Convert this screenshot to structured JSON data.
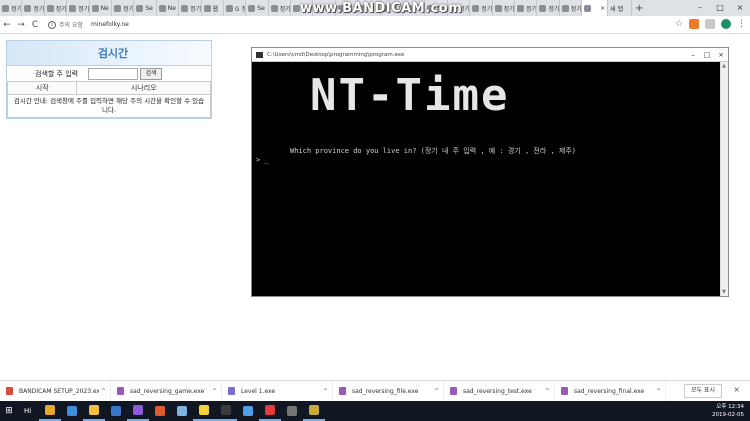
{
  "browser": {
    "tabs": [
      {
        "label": "정기"
      },
      {
        "label": "정기"
      },
      {
        "label": "정기"
      },
      {
        "label": "정기"
      },
      {
        "label": "Ne"
      },
      {
        "label": "정기"
      },
      {
        "label": "Se"
      },
      {
        "label": "Ne"
      },
      {
        "label": "정기"
      },
      {
        "label": "웹"
      },
      {
        "label": "G 정"
      },
      {
        "label": "Se"
      },
      {
        "label": "정기"
      },
      {
        "label": "정기"
      },
      {
        "label": "정기"
      },
      {
        "label": "정기"
      },
      {
        "label": "정기"
      },
      {
        "label": "정기"
      },
      {
        "label": "Ne"
      },
      {
        "label": "정기"
      },
      {
        "label": "정기"
      },
      {
        "label": "정기"
      },
      {
        "label": "정기"
      },
      {
        "label": "정기"
      },
      {
        "label": "정기"
      },
      {
        "label": "정기"
      }
    ],
    "active_tab_close": "×",
    "extra_tab": "새 탭",
    "new_tab": "+",
    "watermark": "www.BANDICAM.com",
    "window_controls": {
      "minimize": "–",
      "maximize": "□",
      "close": "×"
    },
    "address": {
      "security_label": "주의 요함",
      "url": "minefolky.ne"
    },
    "nav": {
      "back": "←",
      "forward": "→",
      "reload": "C"
    }
  },
  "widget": {
    "title": "검시간",
    "search_label": "검색할 주 입력",
    "search_value": "",
    "search_button": "검색",
    "table_headers": [
      "시작",
      "시나리오"
    ],
    "result_text": "검시간 안내: 검색창에 주를 입력하면 해당 주의 시간을 확인할 수 있습니다."
  },
  "console": {
    "title": "C:\\Users\\cmd\\Desktop\\programming\\program.exe",
    "banner": "NT-Time",
    "prompt": "Which province do you live in?   (정기 내 주 입력 , 예 : 경기 , 전라 , 제주)",
    "cursor": "> _",
    "controls": {
      "minimize": "–",
      "maximize": "□",
      "close": "×"
    }
  },
  "downloads": {
    "items": [
      {
        "name": "BANDICAM SETUP_2023.exe",
        "color": "#d94a3a"
      },
      {
        "name": "sad_reversing_game.exe",
        "color": "#9b59b6"
      },
      {
        "name": "Level 1.exe",
        "color": "#7b6dd1"
      },
      {
        "name": "sad_reversing_file.exe",
        "color": "#9b59b6"
      },
      {
        "name": "sad_reversing_test.exe",
        "color": "#9b59b6"
      },
      {
        "name": "sad_reversing_final.exe",
        "color": "#9b59b6"
      }
    ],
    "show_all": "모두 표시",
    "close": "×"
  },
  "taskbar": {
    "search_text": "Hi",
    "apps": [
      {
        "name": "chrome",
        "color": "#e7a72a",
        "running": true
      },
      {
        "name": "edge",
        "color": "#3d8de0",
        "running": false
      },
      {
        "name": "explorer",
        "color": "#f0c23b",
        "running": true
      },
      {
        "name": "mail",
        "color": "#3a77c9",
        "running": false
      },
      {
        "name": "visual-studio",
        "color": "#8e5bd6",
        "running": true
      },
      {
        "name": "debugger",
        "color": "#e05a2f",
        "running": false
      },
      {
        "name": "notepad",
        "color": "#7fb4e3",
        "running": false
      },
      {
        "name": "kakaotalk",
        "color": "#f4d23a",
        "running": true
      },
      {
        "name": "terminal",
        "color": "#3b3b3b",
        "running": true
      },
      {
        "name": "photos",
        "color": "#4f9ee8",
        "running": false
      },
      {
        "name": "record",
        "color": "#e33b3b",
        "running": true
      },
      {
        "name": "bandicam",
        "color": "#777777",
        "running": false
      },
      {
        "name": "visual-studio-2",
        "color": "#c8a93a",
        "running": true
      }
    ],
    "clock_time": "오후 12:34",
    "clock_date": "2019-02-05"
  }
}
